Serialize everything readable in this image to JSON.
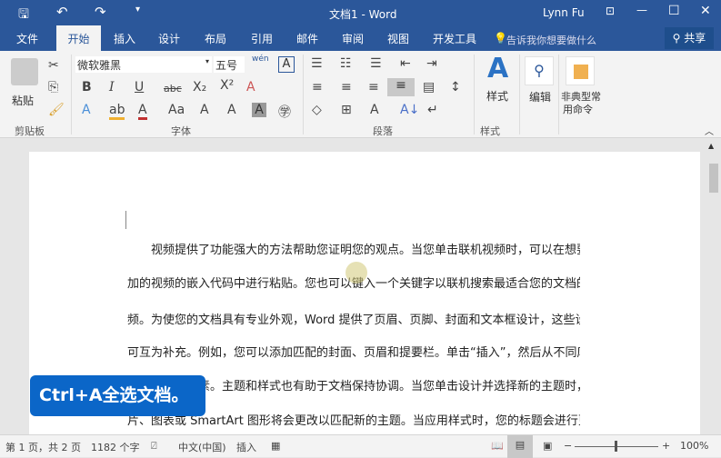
{
  "title": {
    "doc": "文档1 - Word",
    "user": "Lynn Fu"
  },
  "tabs": [
    "文件",
    "开始",
    "插入",
    "设计",
    "布局",
    "引用",
    "邮件",
    "审阅",
    "视图",
    "开发工具"
  ],
  "tell_me": "告诉我你想要做什么",
  "share": "共享",
  "ribbon": {
    "paste": "粘贴",
    "clipboard": "剪贴板",
    "font_name": "微软雅黑",
    "font_size": "五号",
    "phonetic": "wén",
    "font_group": "字体",
    "paragraph_group": "段落",
    "styles": "样式",
    "styles_group": "样式",
    "edit": "编辑",
    "custom_line1": "非典型常",
    "custom_line2": "用命令"
  },
  "document": {
    "lines": [
      "视频提供了功能强大的方法帮助您证明您的观点。当您单击联机视频时，可以在想要添",
      "加的视频的嵌入代码中进行粘贴。您也可以键入一个关键字以联机搜索最适合您的文档的视",
      "频。为使您的文档具有专业外观，Word 提供了页眉、页脚、封面和文本框设计，这些设计",
      "可互为补充。例如，您可以添加匹配的封面、页眉和提要栏。单击“插入”，然后从不同库",
      "中选择所需元素。主题和样式也有助于文档保持协调。当您单击设计并选择新的主题时，图",
      "片、图表或 SmartArt 图形将会更改以匹配新的主题。当应用样式时，您的标题会进行更"
    ]
  },
  "callout": "Ctrl+A全选文档。",
  "status": {
    "page": "第 1 页，共 2 页",
    "words": "1182 个字",
    "lang": "中文(中国)",
    "mode": "插入",
    "zoom": "100%"
  },
  "colors": {
    "brand": "#2b579a",
    "callout": "#0b66c8"
  }
}
